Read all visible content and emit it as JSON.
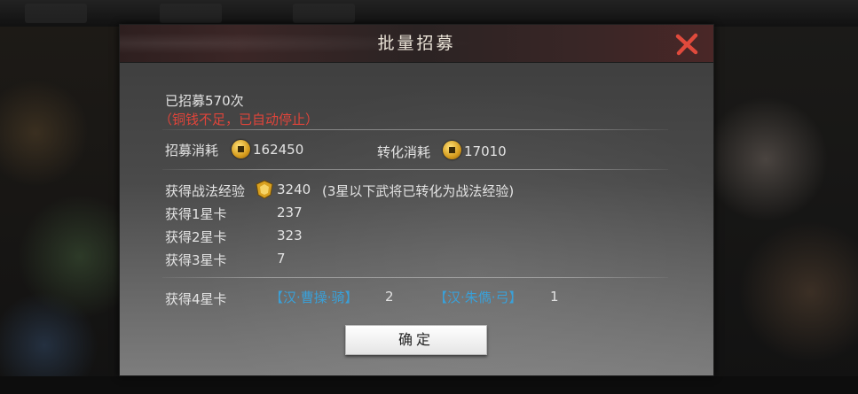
{
  "dialog": {
    "title": "批量招募",
    "recruit_count": "已招募570次",
    "stop_notice": "（铜钱不足，已自动停止）",
    "recruit_cost_label": "招募消耗",
    "recruit_cost_value": "162450",
    "convert_cost_label": "转化消耗",
    "convert_cost_value": "17010",
    "xp_label": "获得战法经验",
    "xp_value": "3240",
    "xp_note": "(3星以下武将已转化为战法经验)",
    "star_rows": [
      {
        "label": "获得1星卡",
        "value": "237"
      },
      {
        "label": "获得2星卡",
        "value": "323"
      },
      {
        "label": "获得3星卡",
        "value": "7"
      }
    ],
    "four_star_label": "获得4星卡",
    "four_star_cards": [
      {
        "name": "【汉·曹操·骑】",
        "count": "2"
      },
      {
        "name": "【汉·朱儁·弓】",
        "count": "1"
      }
    ],
    "confirm_label": "确定"
  },
  "colors": {
    "notice_red": "#e0443a",
    "card_blue": "#3aa0d8",
    "close_red": "#e04a3c"
  },
  "icons": [
    "close-icon",
    "copper-coin-icon",
    "tactic-xp-icon"
  ]
}
